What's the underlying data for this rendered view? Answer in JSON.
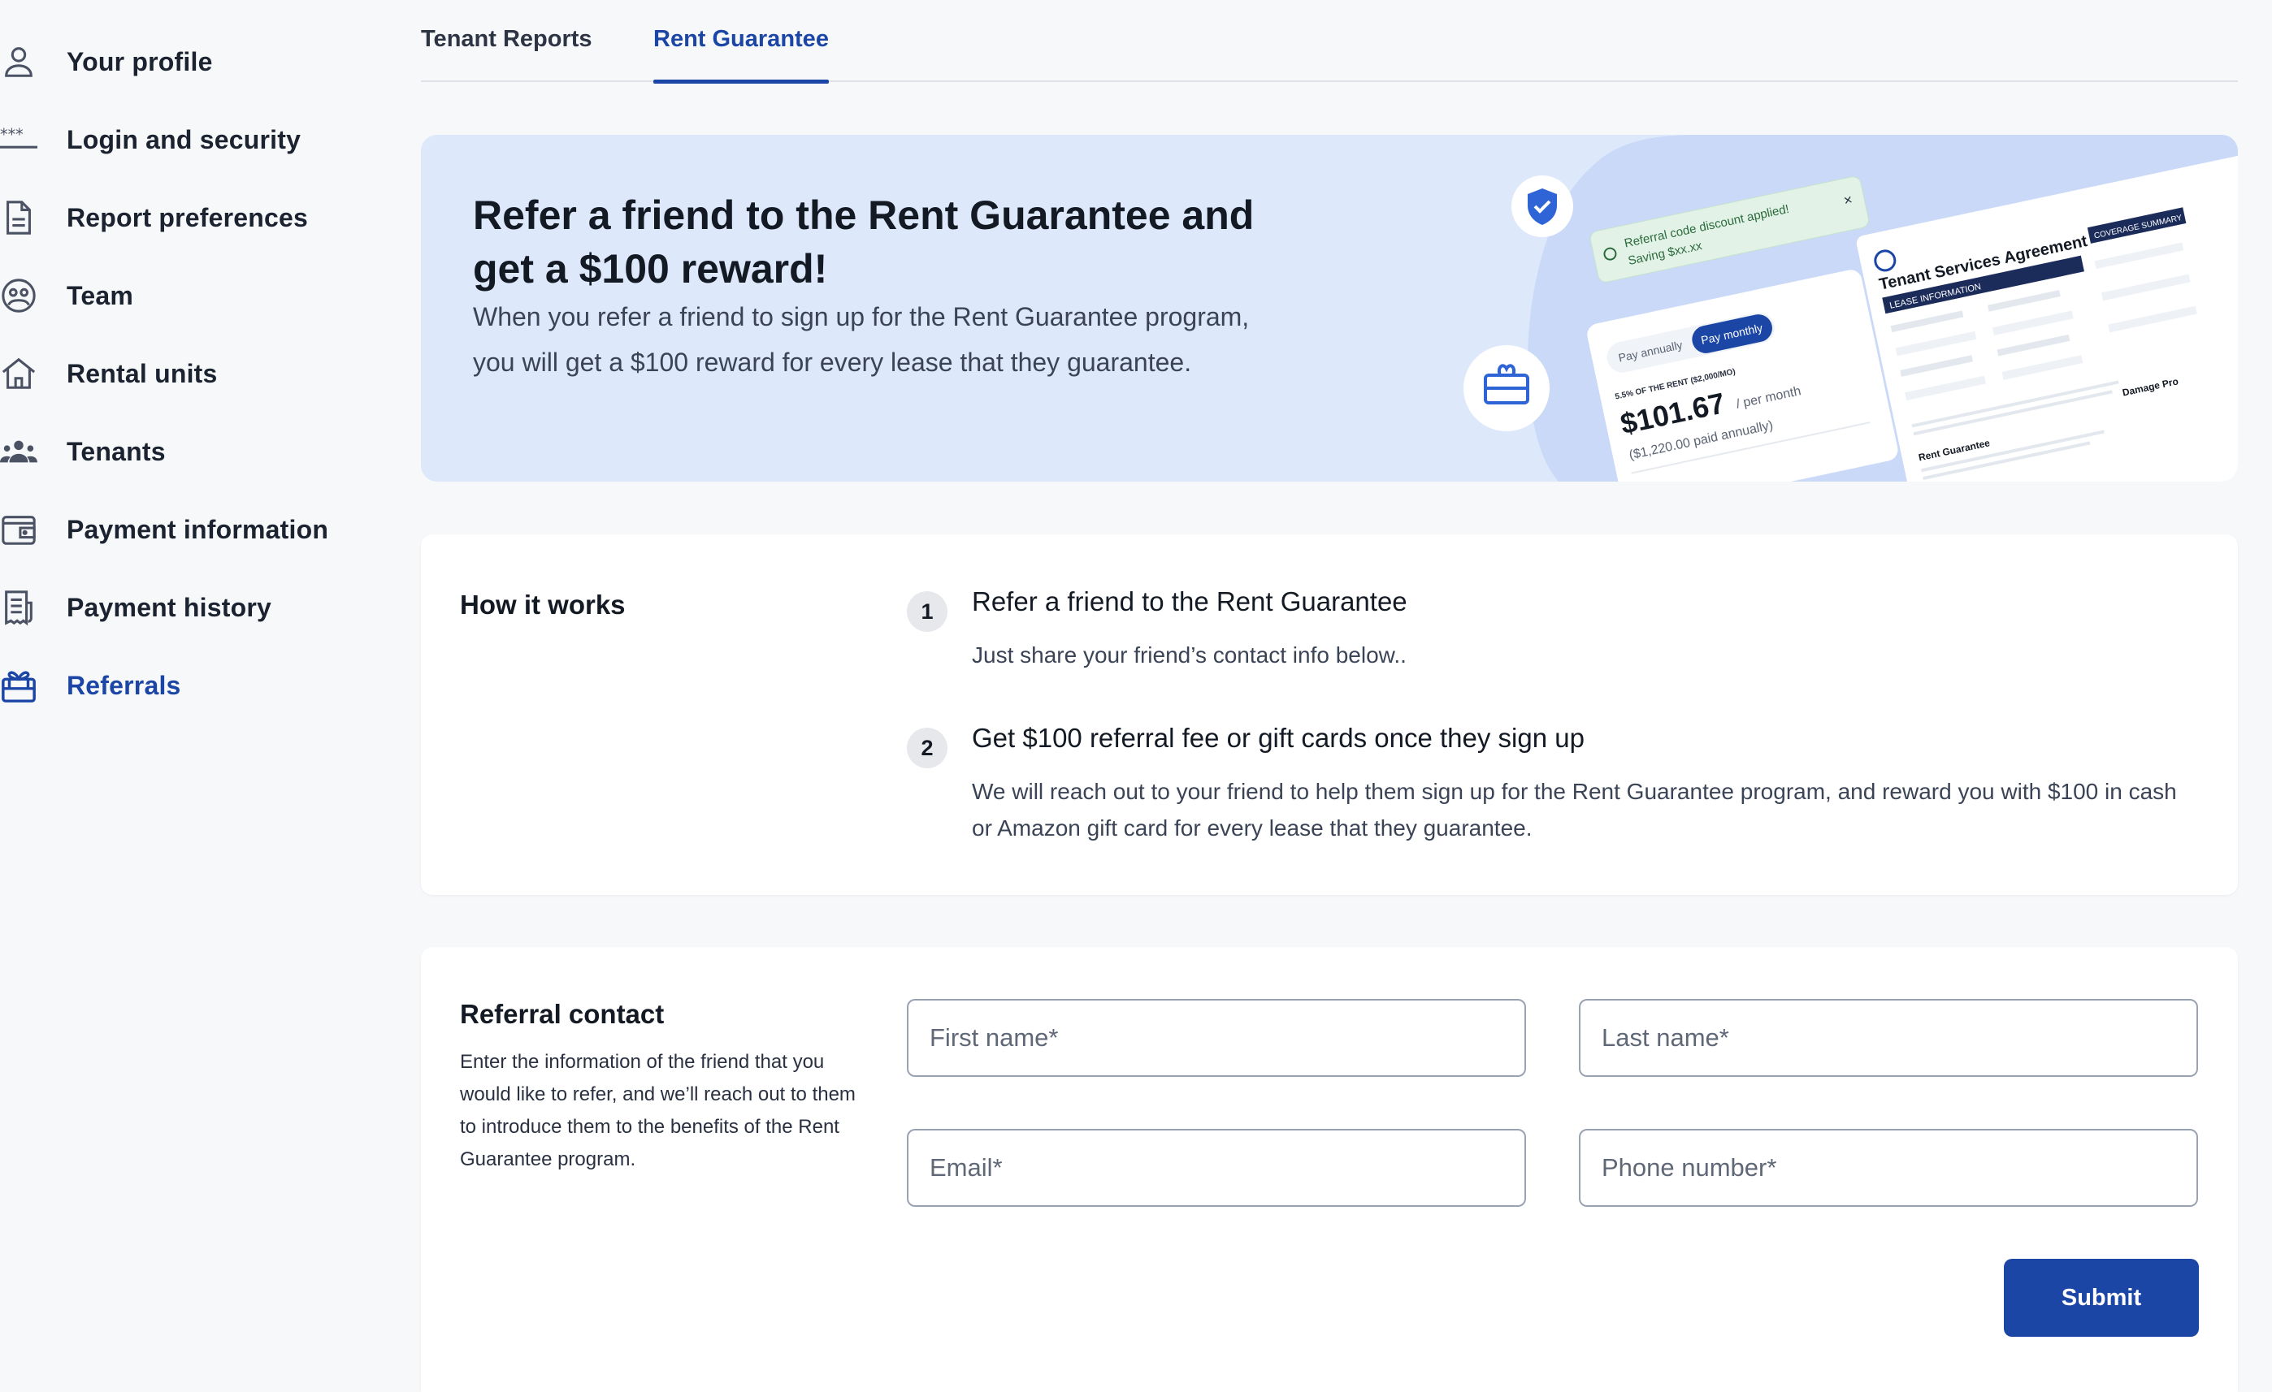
{
  "sidebar": {
    "items": [
      {
        "label": "Your profile",
        "icon": "user-icon"
      },
      {
        "label": "Login and security",
        "icon": "password-icon"
      },
      {
        "label": "Report preferences",
        "icon": "document-icon"
      },
      {
        "label": "Team",
        "icon": "team-icon"
      },
      {
        "label": "Rental units",
        "icon": "house-icon"
      },
      {
        "label": "Tenants",
        "icon": "people-icon"
      },
      {
        "label": "Payment information",
        "icon": "wallet-icon"
      },
      {
        "label": "Payment history",
        "icon": "receipt-icon"
      },
      {
        "label": "Referrals",
        "icon": "gift-icon",
        "active": true
      }
    ]
  },
  "tabs": [
    {
      "label": "Tenant Reports"
    },
    {
      "label": "Rent Guarantee",
      "active": true
    }
  ],
  "hero": {
    "title": "Refer a friend to the Rent Guarantee and get a $100 reward!",
    "description": "When you refer a friend to sign up for the Rent Guarantee program, you will get a $100 reward for every lease that they guarantee.",
    "art": {
      "toast_line1": "Referral code discount applied!",
      "toast_line2": "Saving $xx.xx",
      "toggle_annual": "Pay annually",
      "toggle_monthly": "Pay monthly",
      "rate_caption": "5.5% OF THE RENT ($2,000/MO)",
      "price": "$101.67",
      "price_unit": "/ per month",
      "price_annual": "($1,220.00 paid annually)",
      "doc_title": "Tenant Services Agreement",
      "doc_section": "LEASE INFORMATION",
      "doc_coverage": "COVERAGE SUMMARY",
      "doc_rent_guarantee": "Rent Guarantee",
      "doc_damage": "Damage Pro"
    }
  },
  "how_it_works": {
    "title": "How it works",
    "steps": [
      {
        "number": "1",
        "title": "Refer a friend to the Rent Guarantee",
        "description": "Just share your friend’s contact info below.."
      },
      {
        "number": "2",
        "title": "Get $100 referral fee or gift cards once they sign up",
        "description": "We will reach out to your friend to help them sign up for the Rent Guarantee program, and reward you with $100 in cash or Amazon gift card for every lease that they guarantee."
      }
    ]
  },
  "referral": {
    "title": "Referral contact",
    "description": "Enter the information of the friend that you would like to refer, and we’ll reach out to them to introduce them to the benefits of the Rent Guarantee program.",
    "fields": {
      "first_name": {
        "placeholder": "First name*",
        "value": ""
      },
      "last_name": {
        "placeholder": "Last name*",
        "value": ""
      },
      "email": {
        "placeholder": "Email*",
        "value": ""
      },
      "phone": {
        "placeholder": "Phone number*",
        "value": ""
      }
    },
    "submit_label": "Submit"
  },
  "colors": {
    "accent": "#1c46a6",
    "hero_bg": "#dde8fb",
    "page_bg": "#f7f8fa"
  }
}
